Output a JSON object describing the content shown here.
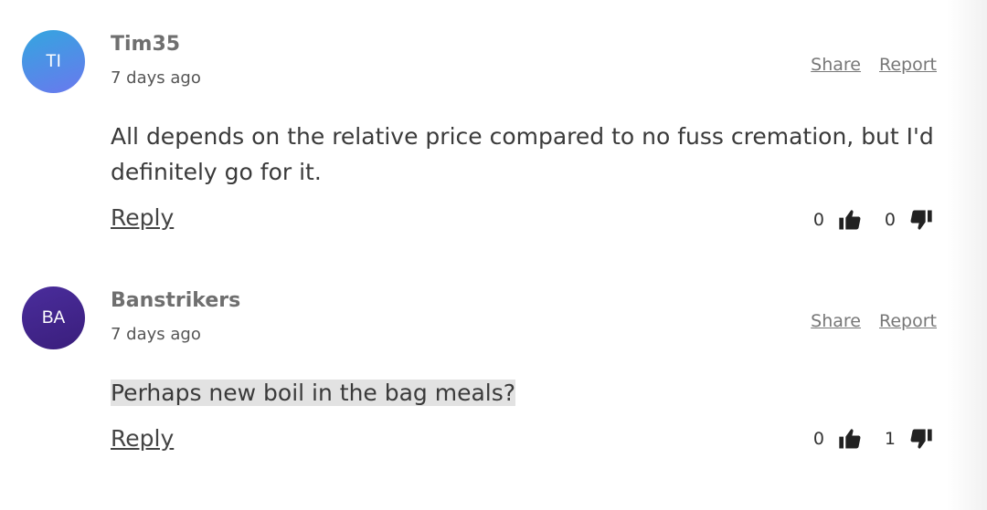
{
  "comments": [
    {
      "initials": "TI",
      "author": "Tim35",
      "time": "7 days ago",
      "share": "Share",
      "report": "Report",
      "text": "All depends on the relative price compared to no fuss cremation, but I'd definitely go for it.",
      "reply": "Reply",
      "likes": "0",
      "dislikes": "0",
      "avatar_colors": [
        "#39a3e0",
        "#7b6ff0"
      ]
    },
    {
      "initials": "BA",
      "author": "Banstrikers",
      "time": "7 days ago",
      "share": "Share",
      "report": "Report",
      "text": "Perhaps new boil in the bag meals?",
      "reply": "Reply",
      "likes": "0",
      "dislikes": "1",
      "avatar_colors": [
        "#4a2c9a",
        "#3b1f7e"
      ]
    }
  ],
  "icons": {
    "like": "thumbs-up-icon",
    "dislike": "thumbs-down-icon"
  }
}
